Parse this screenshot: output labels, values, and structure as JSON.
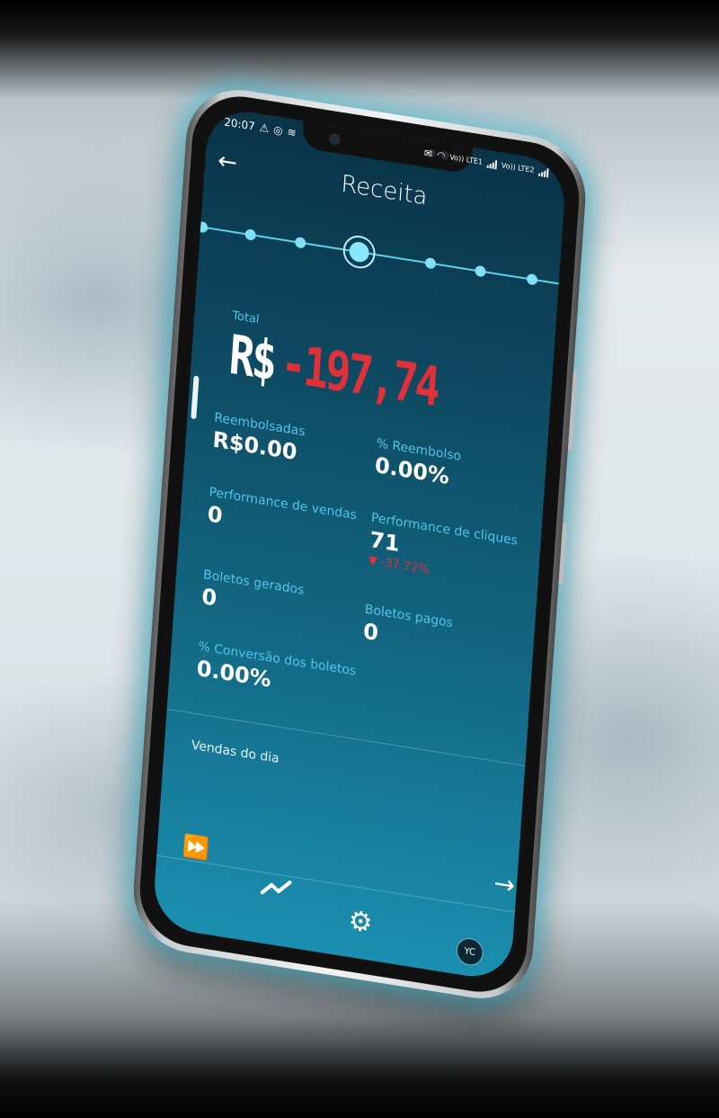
{
  "status_bar": {
    "time": "20:07",
    "left_icons": [
      "warning-icon",
      "whatsapp-icon",
      "sync-icon"
    ],
    "right_icons": [
      "notification-icon",
      "wifi-icon",
      "signal-icon",
      "signal-icon"
    ],
    "sim1": "Vo)) LTE1",
    "sim2": "Vo)) LTE2"
  },
  "header": {
    "title": "Receita",
    "back_icon": "arrow-left-icon"
  },
  "timeline": {
    "points": 7,
    "selected_index": 3
  },
  "summary": {
    "total_label": "Total",
    "currency": "R$",
    "total_value": "-197,74"
  },
  "metrics": {
    "reembolsadas": {
      "label": "Reembolsadas",
      "value": "R$0.00"
    },
    "pct_reembolso": {
      "label": "% Reembolso",
      "value": "0.00%"
    },
    "perf_vendas": {
      "label": "Performance de vendas",
      "value": "0"
    },
    "perf_cliques": {
      "label": "Performance de cliques",
      "value": "71",
      "delta": "▼ -37.72%"
    },
    "boletos_gerados": {
      "label": "Boletos gerados",
      "value": "0"
    },
    "boletos_pagos": {
      "label": "Boletos pagos",
      "value": "0"
    },
    "conversao_boletos": {
      "label": "% Conversão dos boletos",
      "value": "0.00%"
    }
  },
  "sales_day": {
    "label": "Vendas do dia",
    "forward_icon": "arrow-right-icon"
  },
  "bottom_nav": {
    "items": [
      "double-chevron-icon",
      "trend-line-icon",
      "gear-icon"
    ],
    "avatar_initials": "YC"
  },
  "colors": {
    "accent": "#52c4ea",
    "negative": "#e0303a",
    "screen_top": "#0a3348",
    "screen_bottom": "#1b8fb0",
    "glow": "#3cc8e6"
  }
}
